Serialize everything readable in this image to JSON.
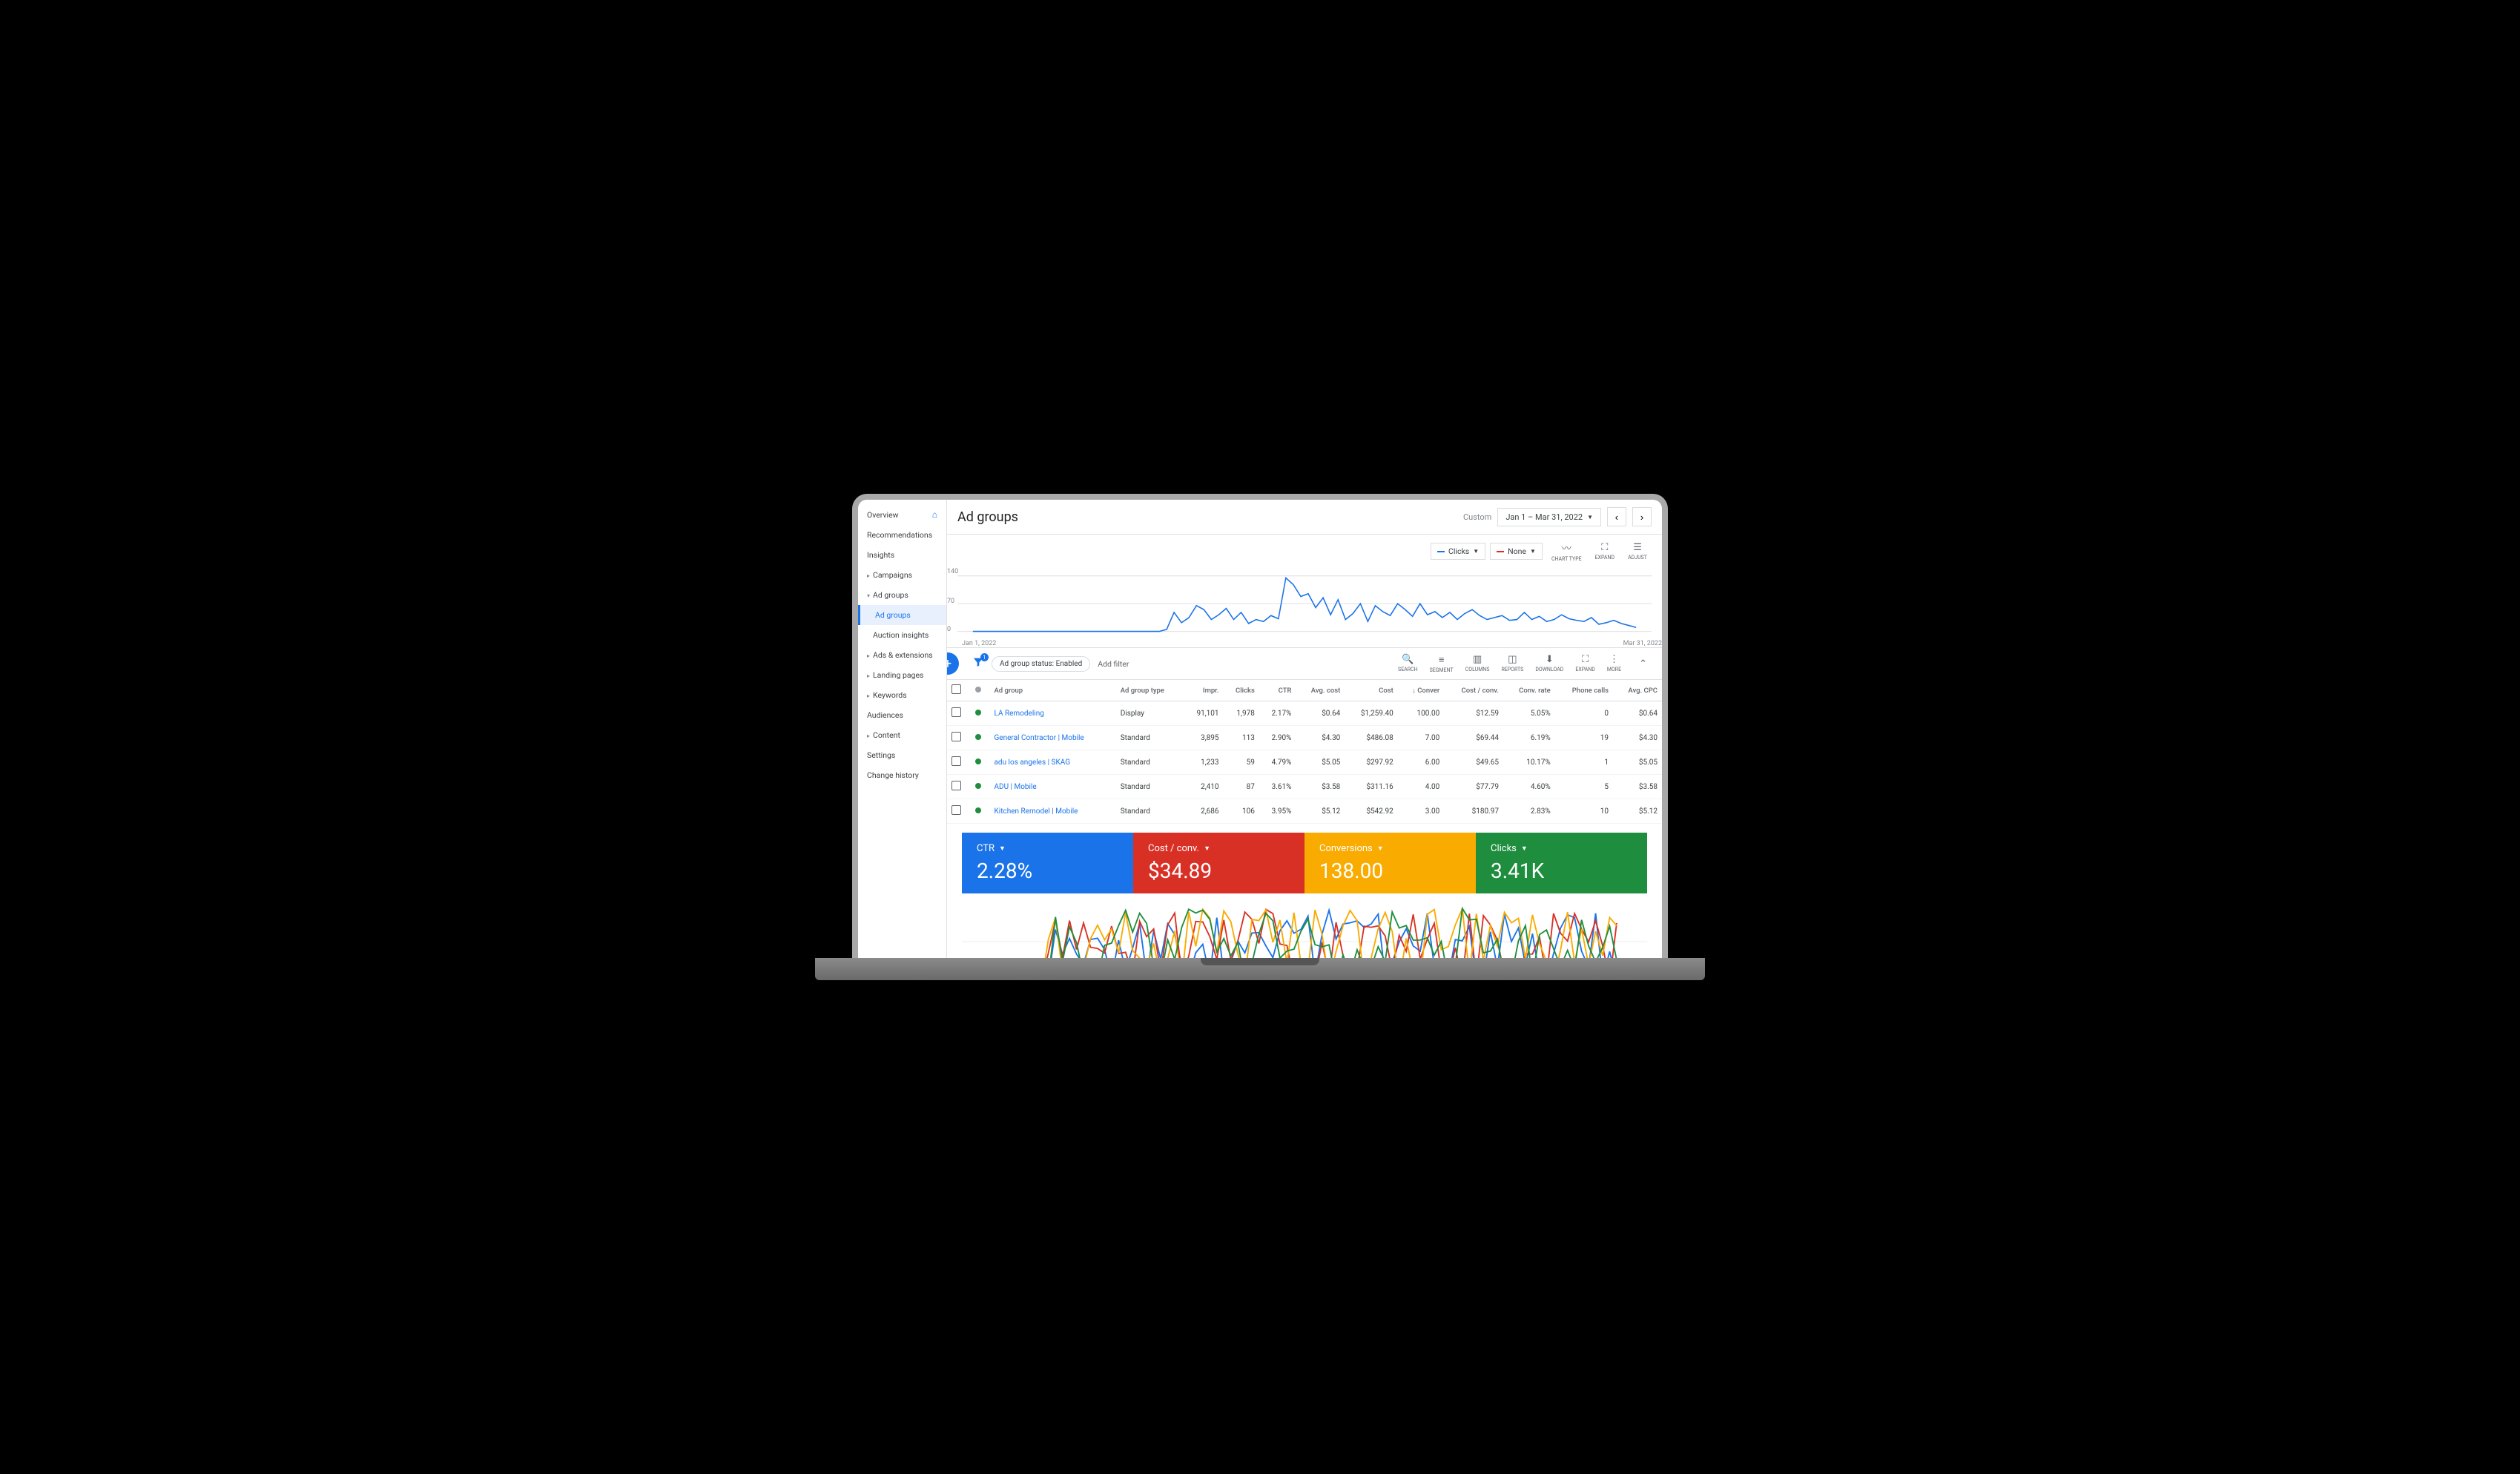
{
  "sidebar": {
    "items": [
      {
        "label": "Overview",
        "home": true
      },
      {
        "label": "Recommendations"
      },
      {
        "label": "Insights"
      },
      {
        "label": "Campaigns",
        "chev": true
      },
      {
        "label": "Ad groups",
        "chev": true,
        "open": true
      },
      {
        "label": "Ad groups",
        "sub": true,
        "active": true
      },
      {
        "label": "Auction insights",
        "sub": true
      },
      {
        "label": "Ads & extensions",
        "chev": true
      },
      {
        "label": "Landing pages",
        "chev": true
      },
      {
        "label": "Keywords",
        "chev": true
      },
      {
        "label": "Audiences"
      },
      {
        "label": "Content",
        "chev": true
      },
      {
        "label": "Settings"
      },
      {
        "label": "Change history"
      }
    ]
  },
  "header": {
    "title": "Ad groups",
    "custom": "Custom",
    "date_range": "Jan 1 – Mar 31, 2022"
  },
  "chart_controls": {
    "metric1": "Clicks",
    "metric2": "None",
    "actions": [
      {
        "id": "chart-type",
        "label": "CHART TYPE"
      },
      {
        "id": "expand",
        "label": "EXPAND"
      },
      {
        "id": "adjust",
        "label": "ADJUST"
      }
    ]
  },
  "toolbar": {
    "filter_count": "1",
    "status_chip": "Ad group status: Enabled",
    "add_filter": "Add filter",
    "actions": [
      {
        "id": "search",
        "label": "SEARCH"
      },
      {
        "id": "segment",
        "label": "SEGMENT"
      },
      {
        "id": "columns",
        "label": "COLUMNS"
      },
      {
        "id": "reports",
        "label": "REPORTS"
      },
      {
        "id": "download",
        "label": "DOWNLOAD"
      },
      {
        "id": "expand",
        "label": "EXPAND"
      },
      {
        "id": "more",
        "label": "MORE"
      }
    ]
  },
  "table": {
    "columns": [
      "",
      "",
      "Ad group",
      "Ad group type",
      "Impr.",
      "Clicks",
      "CTR",
      "Avg. cost",
      "Cost",
      "Conver",
      "Cost / conv.",
      "Conv. rate",
      "Phone calls",
      "Avg. CPC"
    ],
    "sort_col": "Conver",
    "rows": [
      {
        "name": "LA Remodeling",
        "type": "Display",
        "impr": "91,101",
        "clicks": "1,978",
        "ctr": "2.17%",
        "avg_cost": "$0.64",
        "cost": "$1,259.40",
        "conv": "100.00",
        "cpc": "$12.59",
        "cvr": "5.05%",
        "calls": "0",
        "avg_cpc": "$0.64"
      },
      {
        "name": "General Contractor | Mobile",
        "type": "Standard",
        "impr": "3,895",
        "clicks": "113",
        "ctr": "2.90%",
        "avg_cost": "$4.30",
        "cost": "$486.08",
        "conv": "7.00",
        "cpc": "$69.44",
        "cvr": "6.19%",
        "calls": "19",
        "avg_cpc": "$4.30"
      },
      {
        "name": "adu los angeles | SKAG",
        "type": "Standard",
        "impr": "1,233",
        "clicks": "59",
        "ctr": "4.79%",
        "avg_cost": "$5.05",
        "cost": "$297.92",
        "conv": "6.00",
        "cpc": "$49.65",
        "cvr": "10.17%",
        "calls": "1",
        "avg_cpc": "$5.05"
      },
      {
        "name": "ADU | Mobile",
        "type": "Standard",
        "impr": "2,410",
        "clicks": "87",
        "ctr": "3.61%",
        "avg_cost": "$3.58",
        "cost": "$311.16",
        "conv": "4.00",
        "cpc": "$77.79",
        "cvr": "4.60%",
        "calls": "5",
        "avg_cpc": "$3.58"
      },
      {
        "name": "Kitchen Remodel | Mobile",
        "type": "Standard",
        "impr": "2,686",
        "clicks": "106",
        "ctr": "3.95%",
        "avg_cost": "$5.12",
        "cost": "$542.92",
        "conv": "3.00",
        "cpc": "$180.97",
        "cvr": "2.83%",
        "calls": "10",
        "avg_cpc": "$5.12"
      }
    ]
  },
  "kpis": [
    {
      "label": "CTR",
      "value": "2.28%",
      "color": "blue"
    },
    {
      "label": "Cost / conv.",
      "value": "$34.89",
      "color": "red"
    },
    {
      "label": "Conversions",
      "value": "138.00",
      "color": "orange"
    },
    {
      "label": "Clicks",
      "value": "3.41K",
      "color": "green"
    }
  ],
  "chart_data": {
    "top_chart": {
      "type": "line",
      "title": "",
      "xlabel": "",
      "ylabel": "",
      "ylim": [
        0,
        140
      ],
      "x_start": "Jan 1, 2022",
      "x_end": "Mar 31, 2022",
      "yticks": [
        0,
        70,
        140
      ],
      "series": [
        {
          "name": "Clicks",
          "color": "#1a73e8",
          "values": [
            0,
            0,
            0,
            0,
            0,
            0,
            0,
            0,
            0,
            0,
            0,
            0,
            0,
            0,
            0,
            0,
            0,
            0,
            0,
            0,
            0,
            0,
            0,
            0,
            0,
            0,
            5,
            48,
            22,
            35,
            65,
            55,
            30,
            42,
            58,
            30,
            48,
            20,
            30,
            25,
            40,
            32,
            135,
            118,
            88,
            95,
            60,
            85,
            42,
            80,
            30,
            45,
            70,
            25,
            65,
            50,
            40,
            70,
            55,
            38,
            70,
            42,
            50,
            35,
            48,
            30,
            45,
            55,
            40,
            30,
            35,
            40,
            28,
            30,
            48,
            30,
            38,
            25,
            30,
            42,
            32,
            28,
            25,
            35,
            18,
            22,
            28,
            20,
            15,
            10
          ]
        }
      ]
    },
    "bottom_chart": {
      "type": "line",
      "x": {
        "count": 90
      },
      "series": [
        {
          "name": "CTR",
          "color": "#1a73e8"
        },
        {
          "name": "Cost / conv.",
          "color": "#d93025"
        },
        {
          "name": "Conversions",
          "color": "#f9ab00"
        },
        {
          "name": "Clicks",
          "color": "#1e8e3e"
        }
      ]
    }
  }
}
